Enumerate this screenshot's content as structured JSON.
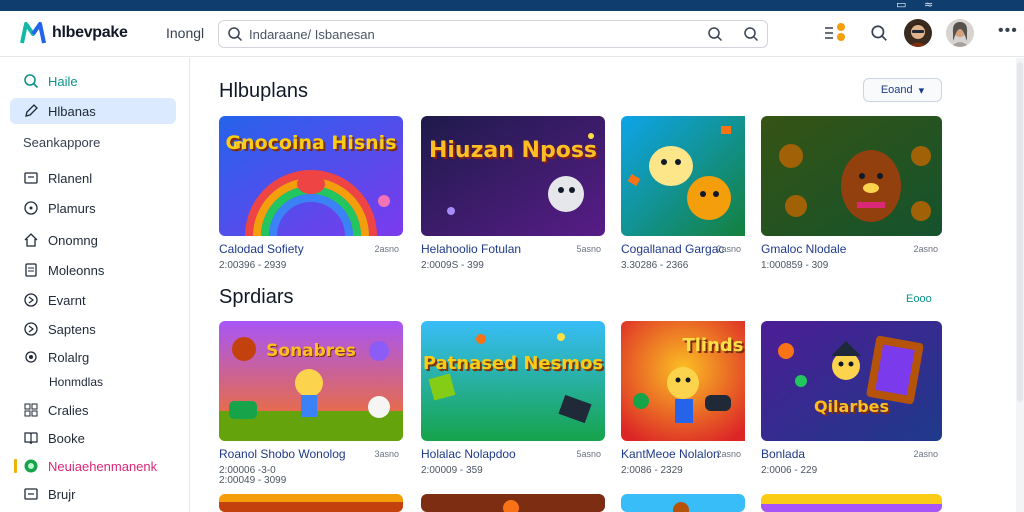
{
  "app": {
    "name": "hlbevpake",
    "nav_link": "Inongl"
  },
  "search": {
    "placeholder": "Indaraane/ Isbanesan"
  },
  "topbar": {
    "icons": [
      "window-icon",
      "wifi-icon"
    ]
  },
  "header": {
    "more_label": "•••"
  },
  "sidebar": {
    "top_items": [
      {
        "label": "Haile",
        "icon": "search-icon"
      },
      {
        "label": "Hlbanas",
        "icon": "edit-icon"
      }
    ],
    "section_label": "Seankappore",
    "items": [
      {
        "label": "Rlanenl",
        "icon": "folder-icon"
      },
      {
        "label": "Plamurs",
        "icon": "clock-icon"
      },
      {
        "label": "Onomng",
        "icon": "home-icon"
      },
      {
        "label": "Moleonns",
        "icon": "document-icon"
      },
      {
        "label": "Evarnt",
        "icon": "chevron-circle-icon"
      },
      {
        "label": "Saptens",
        "icon": "chevron-circle-icon"
      },
      {
        "label": "Rolalrg",
        "icon": "dot-icon"
      },
      {
        "label": "Cralies",
        "icon": "grid-icon"
      },
      {
        "label": "Booke",
        "icon": "book-icon"
      },
      {
        "label": "Neuiaehenmanenk",
        "icon": "circle-badge-icon"
      },
      {
        "label": "Brujr",
        "icon": "archive-icon"
      }
    ],
    "sub_label": "Honmdlas"
  },
  "sections": [
    {
      "title": "Hlbuplans",
      "action_label": "Eoand"
    },
    {
      "title": "Sprdiars",
      "action_label": "Eooo"
    }
  ],
  "cards_row1": [
    {
      "title": "Calodad Sofiety",
      "size": "2asno",
      "meta": "2:00396 - 2939",
      "art_text": "Gnocoina Hisnis"
    },
    {
      "title": "Helahoolio Fotulan",
      "size": "5asno",
      "meta": "2:0009S - 399",
      "art_text": "Hiuzan Nposs"
    },
    {
      "title": "Cogallanad Gargac",
      "size": "2asno",
      "meta": "3.30286 - 2366",
      "art_text": ""
    },
    {
      "title": "Gmaloc Nlodale",
      "size": "2asno",
      "meta": "1:000859 - 309",
      "art_text": ""
    }
  ],
  "cards_row2": [
    {
      "title": "Roanol Shobo Wonolog",
      "size": "3asno",
      "meta": "2:00006 -3-0",
      "meta2": "2:00049 - 3099",
      "art_text": "Sonabres"
    },
    {
      "title": "Holalac Nolapdoo",
      "size": "5asno",
      "meta": "2:00009 - 359",
      "art_text": "Patnased Nesmos"
    },
    {
      "title": "KantMeoe Nolalon",
      "size": "2asno",
      "meta": "2:0086 - 2329",
      "art_text": "Tlinds"
    },
    {
      "title": "Bonlada",
      "size": "2asno",
      "meta": "2:0006 - 229",
      "art_text": "Qilarbes"
    }
  ],
  "colors": {
    "accent": "#0d9488",
    "title_blue": "#1e3a8a",
    "active_bg": "#dbeafe",
    "topstrip": "#0f3d6e"
  }
}
